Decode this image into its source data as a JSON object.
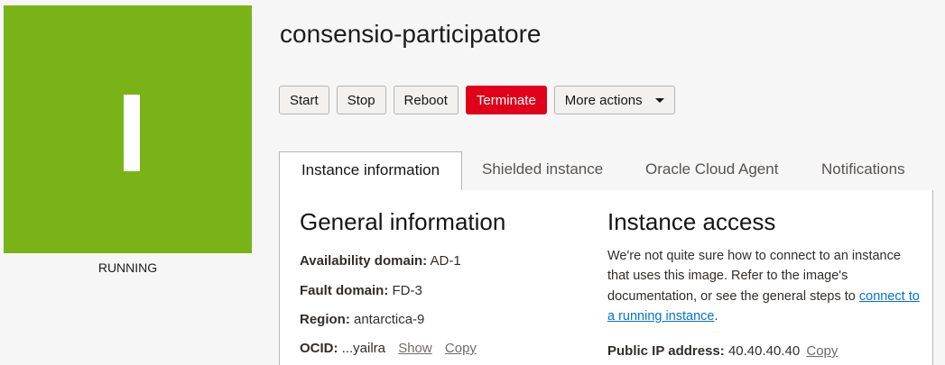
{
  "instance": {
    "name": "consensio-participatore",
    "status": "RUNNING",
    "status_glyph_icon": "instance-running-icon",
    "status_color": "#7ab317"
  },
  "actions": {
    "start": "Start",
    "stop": "Stop",
    "reboot": "Reboot",
    "terminate": "Terminate",
    "more": "More actions"
  },
  "tabs": [
    {
      "label": "Instance information",
      "active": true
    },
    {
      "label": "Shielded instance",
      "active": false
    },
    {
      "label": "Oracle Cloud Agent",
      "active": false
    },
    {
      "label": "Notifications",
      "active": false
    }
  ],
  "general": {
    "title": "General information",
    "availability_domain": {
      "label": "Availability domain:",
      "value": "AD-1"
    },
    "fault_domain": {
      "label": "Fault domain:",
      "value": "FD-3"
    },
    "region": {
      "label": "Region:",
      "value": "antarctica-9"
    },
    "ocid": {
      "label": "OCID:",
      "value": "...yailra",
      "show": "Show",
      "copy": "Copy"
    }
  },
  "access": {
    "title": "Instance access",
    "text": "We're not quite sure how to connect to an instance that uses this image. Refer to the image's documentation, or see the general steps to ",
    "link": "connect to a running instance",
    "text_end": ".",
    "public_ip": {
      "label": "Public IP address:",
      "value": "40.40.40.40",
      "copy": "Copy"
    }
  },
  "colors": {
    "terminate": "#e0001b",
    "link": "#0572ce"
  }
}
